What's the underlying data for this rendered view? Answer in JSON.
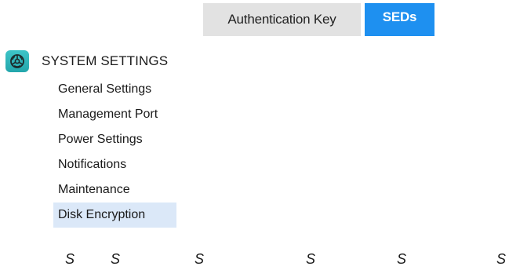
{
  "tabs": [
    {
      "label": "Authentication Key",
      "active": false
    },
    {
      "label": "SEDs",
      "active": true
    }
  ],
  "section": {
    "title": "SYSTEM SETTINGS",
    "icon": "system-settings-icon"
  },
  "nav": {
    "items": [
      {
        "label": "General Settings"
      },
      {
        "label": "Management Port"
      },
      {
        "label": "Power Settings"
      },
      {
        "label": "Notifications"
      },
      {
        "label": "Maintenance"
      },
      {
        "label": "Disk Encryption",
        "active": true
      }
    ]
  },
  "footer": {
    "letters": [
      "S",
      "S",
      "S",
      "S",
      "S",
      "S"
    ]
  },
  "colors": {
    "active_tab": "#1e90f0",
    "inactive_tab": "#e2e2e2",
    "active_nav": "#dbe8f8",
    "icon_bg": "#23a6ac"
  }
}
